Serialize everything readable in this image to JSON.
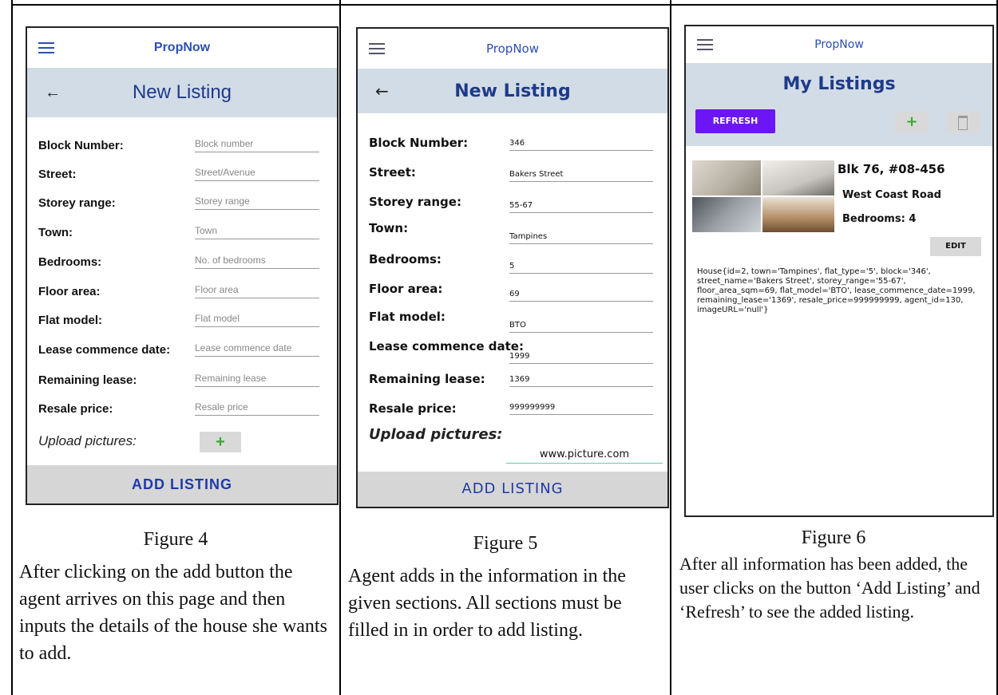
{
  "app": {
    "brand": "PropNow"
  },
  "figure4": {
    "title": "New Listing",
    "fields": [
      {
        "label": "Block Number:",
        "placeholder": "Block number"
      },
      {
        "label": "Street:",
        "placeholder": "Street/Avenue"
      },
      {
        "label": "Storey range:",
        "placeholder": "Storey range"
      },
      {
        "label": "Town:",
        "placeholder": "Town"
      },
      {
        "label": "Bedrooms:",
        "placeholder": "No. of bedrooms"
      },
      {
        "label": "Floor area:",
        "placeholder": "Floor area"
      },
      {
        "label": "Flat model:",
        "placeholder": "Flat model"
      },
      {
        "label": "Lease commence date:",
        "placeholder": "Lease commence date"
      },
      {
        "label": "Remaining lease:",
        "placeholder": "Remaining lease"
      },
      {
        "label": "Resale price:",
        "placeholder": "Resale price"
      }
    ],
    "upload_label": "Upload pictures:",
    "plus": "+",
    "add_button": "ADD LISTING",
    "fig_label": "Figure 4",
    "caption": "After clicking on the add button the agent arrives on this page and then inputs the details of the house she wants to add."
  },
  "figure5": {
    "title": "New Listing",
    "fields": [
      {
        "label": "Block Number:",
        "value": "346"
      },
      {
        "label": "Street:",
        "value": "Bakers Street"
      },
      {
        "label": "Storey range:",
        "value": "55-67"
      },
      {
        "label": "Town:",
        "value": "Tampines"
      },
      {
        "label": "Bedrooms:",
        "value": "5"
      },
      {
        "label": "Floor area:",
        "value": "69"
      },
      {
        "label": "Flat model:",
        "value": "BTO"
      },
      {
        "label": "Lease commence date:",
        "value": "1999"
      },
      {
        "label": "Remaining lease:",
        "value": "1369"
      },
      {
        "label": "Resale price:",
        "value": "999999999"
      }
    ],
    "upload_label": "Upload pictures:",
    "picture_url": "www.picture.com",
    "add_button": "ADD LISTING",
    "fig_label": "Figure 5",
    "caption": "Agent adds in the information in the given sections. All sections must be filled in in order to add listing."
  },
  "figure6": {
    "title": "My Listings",
    "refresh_button": "REFRESH",
    "plus": "+",
    "listing": {
      "line1": "Blk 76, #08-456",
      "line2": "West Coast Road",
      "line3": "Bedrooms: 4",
      "edit_button": "EDIT"
    },
    "debug_text": "House{id=2, town='Tampines', flat_type='5', block='346', street_name='Bakers Street', storey_range='55-67', floor_area_sqm=69, flat_model='BTO', lease_commence_date=1999, remaining_lease='1369', resale_price=999999999, agent_id=130, imageURL='null'}",
    "fig_label": "Figure 6",
    "caption": "After all information has been added, the user clicks on the button ‘Add Listing’ and ‘Refresh’ to see the added listing."
  }
}
